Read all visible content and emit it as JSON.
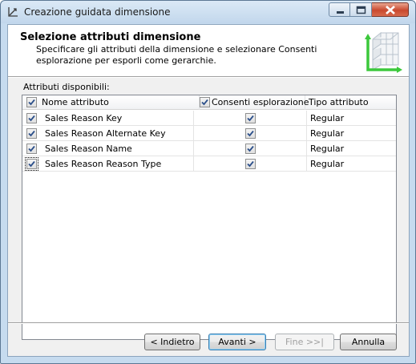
{
  "window": {
    "title": "Creazione guidata dimensione",
    "icon": "wizard-icon"
  },
  "header": {
    "title": "Selezione attributi dimensione",
    "description": "Specificare gli attributi della dimensione e selezionare Consenti esplorazione per esporli come gerarchie."
  },
  "list": {
    "label": "Attributi disponibili:",
    "columns": {
      "name": "Nome attributo",
      "browse": "Consenti esplorazione",
      "type": "Tipo attributo"
    },
    "header_checks": {
      "name": true,
      "browse": true
    },
    "rows": [
      {
        "name": "Sales Reason Key",
        "type": "Regular",
        "selected": true,
        "browse": true
      },
      {
        "name": "Sales Reason Alternate Key",
        "type": "Regular",
        "selected": true,
        "browse": true
      },
      {
        "name": "Sales Reason Name",
        "type": "Regular",
        "selected": true,
        "browse": true
      },
      {
        "name": "Sales Reason Reason Type",
        "type": "Regular",
        "selected": true,
        "browse": true
      }
    ]
  },
  "buttons": {
    "back": "< Indietro",
    "next": "Avanti >",
    "finish": "Fine >>|",
    "cancel": "Annulla"
  },
  "colors": {
    "titlebar": "#c6dbef",
    "check": "#2b4f8a"
  }
}
